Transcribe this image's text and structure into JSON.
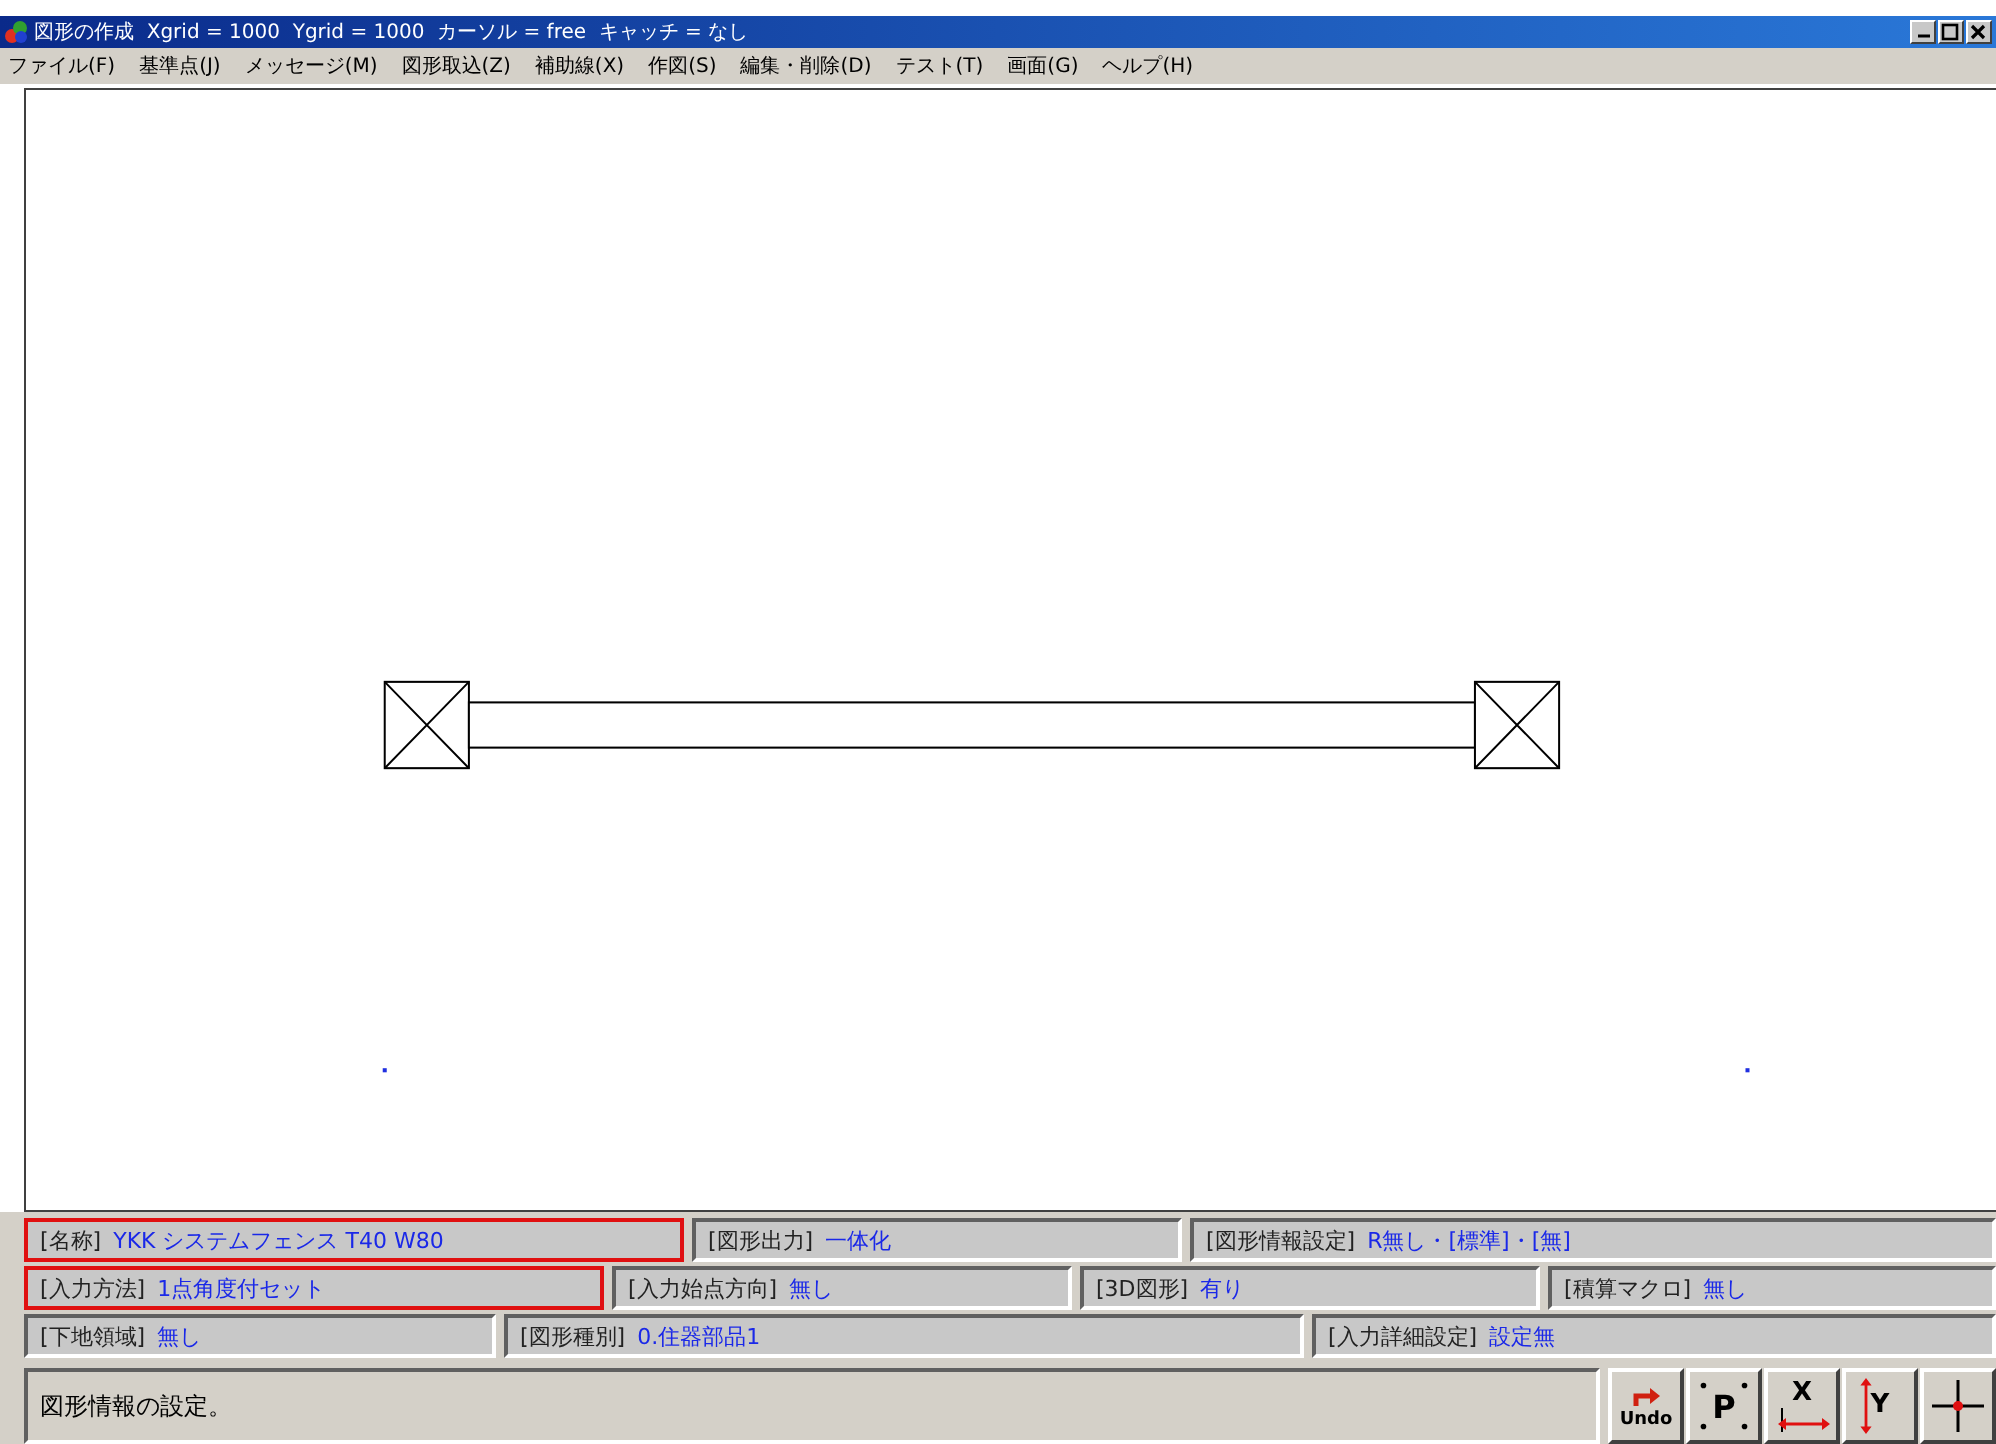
{
  "window": {
    "title": "図形の作成  Xgrid = 1000  Ygrid = 1000  カーソル = free  キャッチ = なし"
  },
  "menu": [
    "ファイル(F)",
    "基準点(J)",
    "メッセージ(M)",
    "図形取込(Z)",
    "補助線(X)",
    "作図(S)",
    "編集・削除(D)",
    "テスト(T)",
    "画面(G)",
    "ヘルプ(H)"
  ],
  "info_rows": [
    [
      {
        "label": "[名称]",
        "value": "YKK システムフェンス T40 W80",
        "highlighted": true
      },
      {
        "label": "[図形出力]",
        "value": "一体化",
        "highlighted": false
      },
      {
        "label": "[図形情報設定]",
        "value": "R無し・[標準]・[無]",
        "highlighted": false
      }
    ],
    [
      {
        "label": "[入力方法]",
        "value": "1点角度付セット",
        "highlighted": true
      },
      {
        "label": "[入力始点方向]",
        "value": "無し",
        "highlighted": false
      },
      {
        "label": "[3D図形]",
        "value": "有り",
        "highlighted": false
      },
      {
        "label": "[積算マクロ]",
        "value": "無し",
        "highlighted": false
      }
    ],
    [
      {
        "label": "[下地領域]",
        "value": "無し",
        "highlighted": false
      },
      {
        "label": "[図形種別]",
        "value": "0.住器部品1",
        "highlighted": false
      },
      {
        "label": "[入力詳細設定]",
        "value": "設定無",
        "highlighted": false
      }
    ]
  ],
  "status_bar": {
    "message": "図形情報の設定。"
  },
  "tools": [
    {
      "kind": "undo",
      "label": "Undo"
    },
    {
      "kind": "point",
      "label": "P"
    },
    {
      "kind": "x",
      "label": "X"
    },
    {
      "kind": "y",
      "label": "Y"
    },
    {
      "kind": "cross"
    }
  ]
}
